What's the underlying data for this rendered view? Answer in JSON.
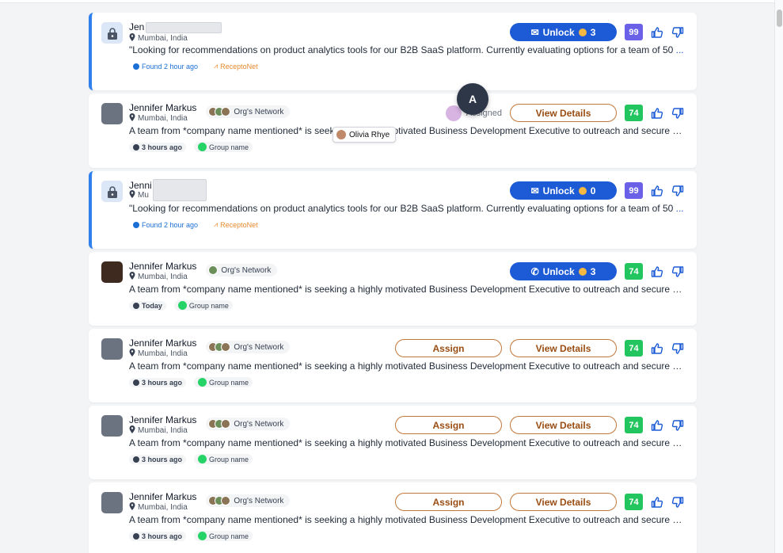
{
  "colors": {
    "primary": "#1d5bd6",
    "score_purple": "#6a61e8",
    "score_green": "#22c55e",
    "outline": "#c2773a"
  },
  "assigned_badge": {
    "initial": "A",
    "assigned_text": "Assigned"
  },
  "tooltip": {
    "name": "Olivia Rhye"
  },
  "cards": [
    {
      "name": "Jen",
      "location": "Mumbai, India",
      "unlock_label": "Unlock",
      "cost": "3",
      "score": "99",
      "message": "\"Looking for recommendations on product analytics tools for our B2B SaaS platform. Currently evaluating options for a team of 50",
      "tag_found": "Found 2 hour ago",
      "tag_source": "ReceptoNet"
    },
    {
      "name": "Jennifer Markus",
      "location": "Mumbai, India",
      "network": "Org's Network",
      "view_label": "View Details",
      "score": "74",
      "message": "A team from *company name mentioned* is seeking a highly motivated Business Development Executive to outreach and secure bo...",
      "tag_time": "3 hours ago",
      "tag_group": "Group name"
    },
    {
      "name": "Jenni",
      "location": "Mu",
      "unlock_label": "Unlock",
      "cost": "0",
      "score": "99",
      "message": "\"Looking for recommendations on product analytics tools for our B2B SaaS platform. Currently evaluating options for a team of 50",
      "tag_found": "Found 2 hour ago",
      "tag_source": "ReceptoNet"
    },
    {
      "name": "Jennifer Markus",
      "location": "Mumbai, India",
      "network": "Org's Network",
      "unlock_label": "Unlock",
      "cost": "3",
      "score": "74",
      "message": "A team from *company name mentioned* is seeking a highly motivated Business Development Executive to outreach and secure bo...",
      "tag_time": "Today",
      "tag_group": "Group name"
    },
    {
      "name": "Jennifer Markus",
      "location": "Mumbai, India",
      "network": "Org's Network",
      "assign_label": "Assign",
      "view_label": "View Details",
      "score": "74",
      "message": "A team from *company name mentioned* is seeking a highly motivated Business Development Executive to outreach and secure bo...",
      "tag_time": "3 hours ago",
      "tag_group": "Group name"
    },
    {
      "name": "Jennifer Markus",
      "location": "Mumbai, India",
      "network": "Org's Network",
      "assign_label": "Assign",
      "view_label": "View Details",
      "score": "74",
      "message": "A team from *company name mentioned* is seeking a highly motivated Business Development Executive to outreach and secure bo...",
      "tag_time": "3 hours ago",
      "tag_group": "Group name"
    },
    {
      "name": "Jennifer Markus",
      "location": "Mumbai, India",
      "network": "Org's Network",
      "assign_label": "Assign",
      "view_label": "View Details",
      "score": "74",
      "message": "A team from *company name mentioned* is seeking a highly motivated Business Development Executive to outreach and secure bo...",
      "tag_time": "3 hours ago",
      "tag_group": "Group name"
    }
  ]
}
